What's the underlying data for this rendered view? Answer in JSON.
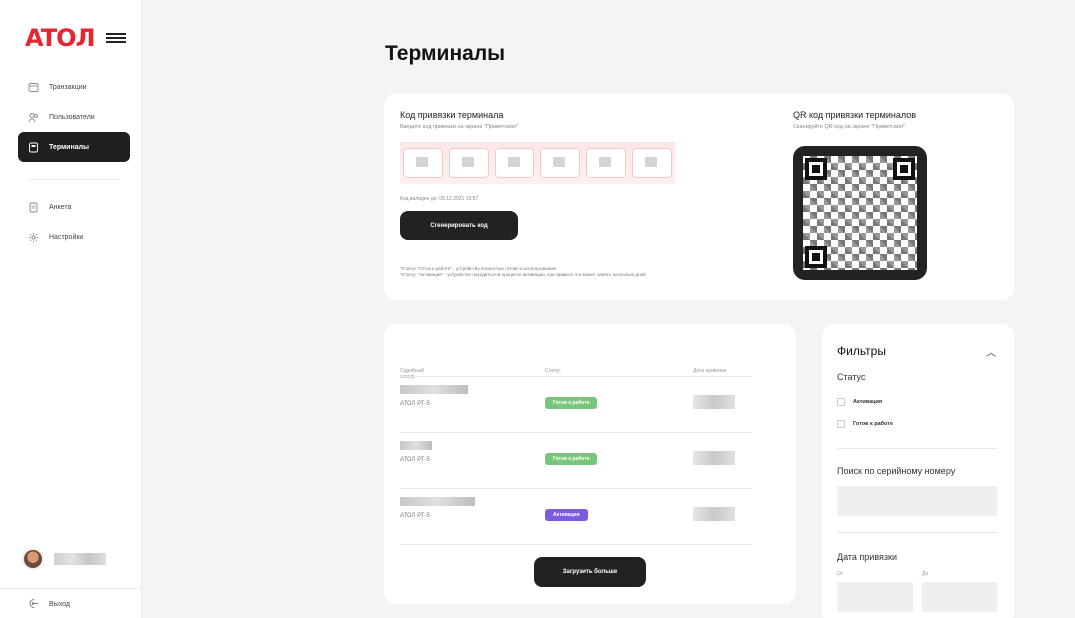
{
  "brand": {
    "logo": "ATOЛ",
    "accent": "#e3262f"
  },
  "sidebar": {
    "items": [
      {
        "label": "Транзакции",
        "icon": "transactions-icon"
      },
      {
        "label": "Пользователи",
        "icon": "users-icon"
      },
      {
        "label": "Терминалы",
        "icon": "terminal-icon",
        "active": true
      },
      {
        "label": "Анкета",
        "icon": "form-icon"
      },
      {
        "label": "Настройки",
        "icon": "settings-icon"
      }
    ],
    "logout": "Выход"
  },
  "page": {
    "title": "Терминалы"
  },
  "binding": {
    "title": "Код привязки терминала",
    "hint": "Введите код привязки на экране \"Приветсвия\"",
    "expires": "Код валиден до: 06.12.2021 13:57",
    "generate_button": "Сгенерировать код",
    "note1": "*Статус \"Готов к работе\" - устройство полностью готово к использованию",
    "note2": "*Статус \"Активация\" - устройство находиться в процессе активации, как правило это может занять несколько дней"
  },
  "qr": {
    "title": "QR код привязки терминалов",
    "hint": "Сканируйте QR код на экране \"Приветсвия\""
  },
  "table": {
    "columns": [
      "Серийный номер",
      "Статус",
      "Дата привязки"
    ],
    "rows": [
      {
        "model": "АТОЛ РТ-5",
        "status": "Готов к работе"
      },
      {
        "model": "АТОЛ РТ-5",
        "status": "Готов к работе"
      },
      {
        "model": "АТОЛ РТ-5",
        "status": "Активация"
      }
    ],
    "load_more": "Загрузить больше",
    "colors": {
      "ready": "#78c57c",
      "activation": "#7d5be0"
    }
  },
  "filters": {
    "title": "Фильтры",
    "status_label": "Статус",
    "options": [
      "Активация",
      "Готов к работе"
    ],
    "serial_label": "Поиск по серийному номеру",
    "date_label": "Дата привязки",
    "from": "От",
    "to": "До"
  }
}
